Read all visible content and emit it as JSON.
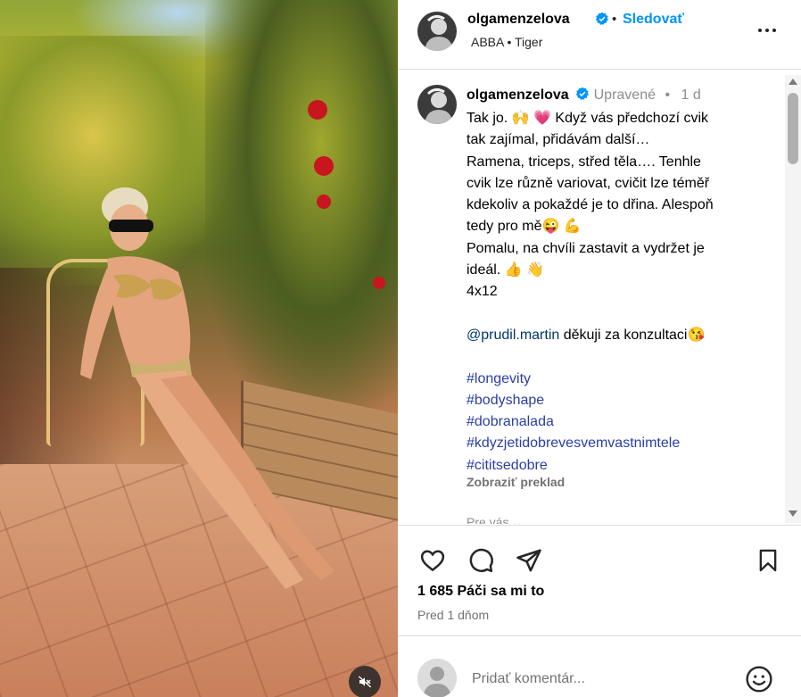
{
  "post": {
    "username": "olgamenzelova",
    "follow_label": "Sledovať",
    "dot": "•",
    "music": "ABBA • Tiger"
  },
  "caption": {
    "username": "olgamenzelova",
    "edited": "Upravené",
    "age_dot": "•",
    "age": "1 d",
    "lines": [
      "Tak jo. 🙌 💗  Když vás předchozí cvik",
      "tak zajímal, přidávám další…",
      "Ramena, triceps, střed těla…. Tenhle",
      "cvik lze různě variovat, cvičit lze téměř",
      "kdekoliv a pokaždé je to dřina. Alespoň",
      "tedy pro mě😜 💪",
      "Pomalu, na chvíli zastavit a vydržet je",
      "ideál. 👍 👋",
      "4x12"
    ],
    "mention": "@prudil.martin",
    "mention_text": "  děkuji za konzultaci😘",
    "hashtags": [
      "#longevity",
      "#bodyshape",
      "#dobranalada",
      "#kdyzjetidobrevesvemvastnimtele",
      "#cititsedobre"
    ],
    "translate_label": "Zobraziť preklad",
    "for_you": "Pre vás ⌄"
  },
  "stats": {
    "likes": "1 685 Páči sa mi to",
    "posted": "Pred 1 dňom"
  },
  "comment": {
    "placeholder": "Pridať komentár..."
  },
  "icons": {
    "verified": "verified-badge-icon",
    "more": "more-options-icon",
    "like": "heart-icon",
    "comment": "comment-bubble-icon",
    "share": "paper-plane-icon",
    "save": "bookmark-icon",
    "emoji": "emoji-smiley-icon",
    "mute": "speaker-muted-icon"
  },
  "colors": {
    "accent": "#0095f6",
    "hashtag": "#2a3ea5",
    "secondary_text": "#737373",
    "divider": "#dbdbdb"
  }
}
